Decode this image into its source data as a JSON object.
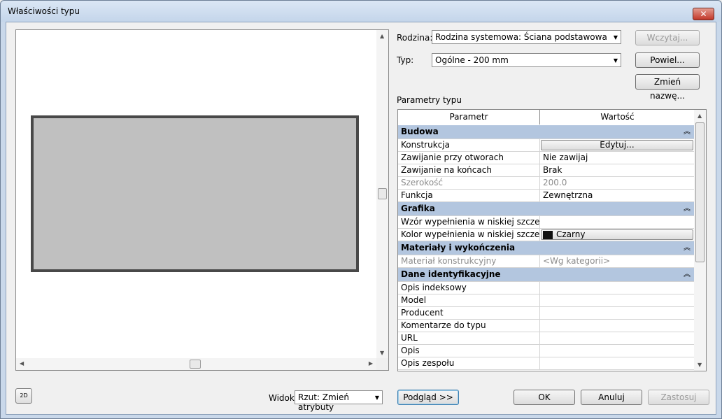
{
  "window": {
    "title": "Właściwości typu",
    "close_glyph": "✕"
  },
  "family": {
    "label": "Rodzina:",
    "value": "Rodzina systemowa: Ściana podstawowa"
  },
  "type": {
    "label": "Typ:",
    "value": "Ogólne - 200 mm"
  },
  "buttons": {
    "load": "Wczytaj...",
    "duplicate": "Powiel...",
    "rename": "Zmień nazwę...",
    "preview": "Podgląd >>",
    "ok": "OK",
    "cancel": "Anuluj",
    "apply": "Zastosuj"
  },
  "params": {
    "title": "Parametry typu",
    "col_param": "Parametr",
    "col_value": "Wartość",
    "collapse_glyph": "≈",
    "groups": [
      {
        "name": "Budowa",
        "rows": [
          {
            "param": "Konstrukcja",
            "value": "Edytuj..."
          },
          {
            "param": "Zawijanie przy otworach",
            "value": "Nie zawijaj"
          },
          {
            "param": "Zawijanie na końcach",
            "value": "Brak"
          },
          {
            "param": "Szerokość",
            "value": "200.0"
          },
          {
            "param": "Funkcja",
            "value": "Zewnętrzna"
          }
        ]
      },
      {
        "name": "Grafika",
        "rows": [
          {
            "param": "Wzór wypełnienia w niskiej szczegóło",
            "value": ""
          },
          {
            "param": "Kolor wypełnienia w niskiej szczegóło",
            "value": "Czarny"
          }
        ]
      },
      {
        "name": "Materiały i wykończenia",
        "rows": [
          {
            "param": "Materiał konstrukcyjny",
            "value": "<Wg kategorii>"
          }
        ]
      },
      {
        "name": "Dane identyfikacyjne",
        "rows": [
          {
            "param": "Opis indeksowy",
            "value": ""
          },
          {
            "param": "Model",
            "value": ""
          },
          {
            "param": "Producent",
            "value": ""
          },
          {
            "param": "Komentarze do typu",
            "value": ""
          },
          {
            "param": "URL",
            "value": ""
          },
          {
            "param": "Opis",
            "value": ""
          },
          {
            "param": "Opis zespołu",
            "value": ""
          }
        ]
      }
    ]
  },
  "view": {
    "label": "Widok:",
    "value": "Rzut: Zmień atrybuty"
  },
  "icons": {
    "view2d": "2D"
  },
  "colors": {
    "group_header": "#b3c6df",
    "fill_color": "#111111"
  }
}
